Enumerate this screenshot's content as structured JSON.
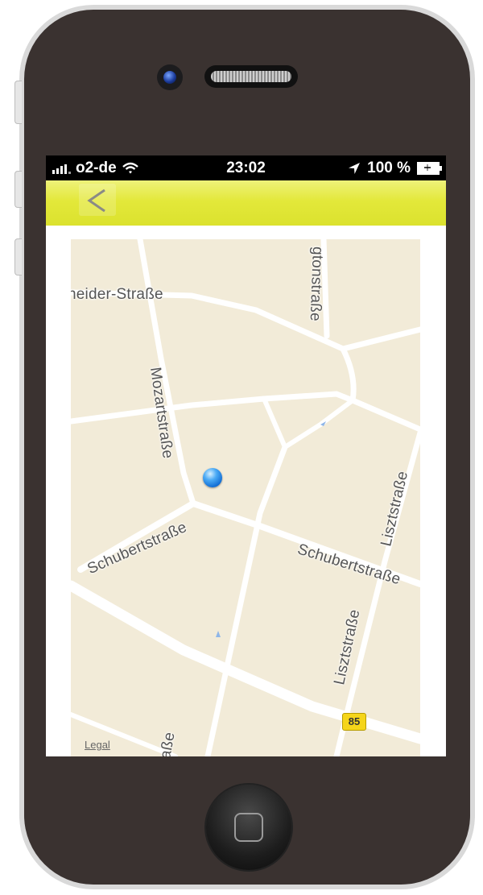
{
  "status_bar": {
    "carrier": "o2-de",
    "time": "23:02",
    "battery": "100 %",
    "icons": [
      "signal-bars-icon",
      "wifi-icon",
      "location-arrow-icon",
      "battery-icon"
    ]
  },
  "nav_bar": {
    "back_icon": "chevron-left-icon",
    "accent_color": "#e1e63a"
  },
  "map": {
    "streets": [
      "neider-Straße",
      "gtonstraße",
      "Mozartstraße",
      "Schubertstraße",
      "Schubertstraße",
      "Lisztstraße",
      "Lisztstraße",
      "aße"
    ],
    "route_number": "85",
    "legal_label": "Legal",
    "location_marker": "current-location-icon"
  },
  "device": {
    "home_button_icon": "home-button-icon"
  }
}
